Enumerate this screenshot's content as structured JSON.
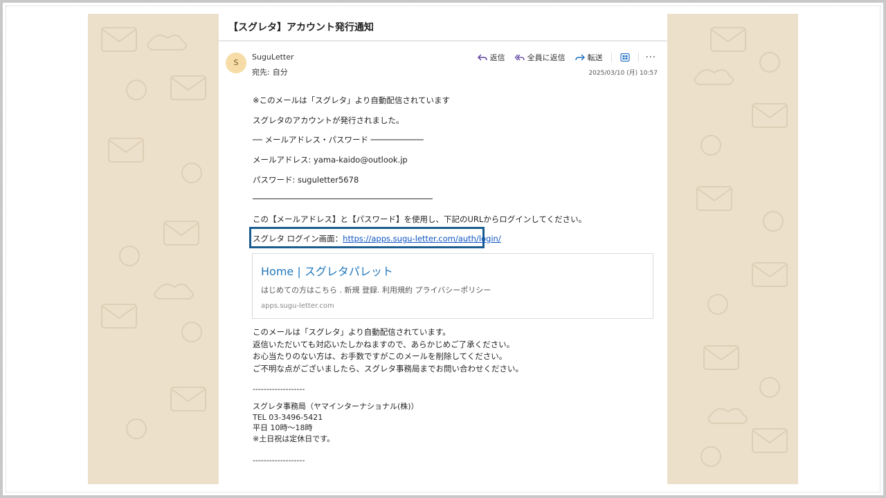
{
  "email": {
    "subject": "【スグレタ】アカウント発行通知",
    "sender_initial": "S",
    "sender_name": "SuguLetter",
    "recipient_label": "宛先:",
    "recipient_name": "自分",
    "date": "2025/03/10 (月) 10:57"
  },
  "actions": {
    "reply": "返信",
    "reply_all": "全員に返信",
    "forward": "転送",
    "more": "···"
  },
  "body": {
    "line1": "※このメールは「スグレタ」より自動配信されています",
    "line2": "スグレタのアカウントが発行されました。",
    "line3": "── メールアドレス・パスワード ───────────",
    "email_line": "メールアドレス: yama-kaido@outlook.jp",
    "password_line": "パスワード: suguletter5678",
    "instruction": "この【メールアドレス】と【パスワード】を使用し、下記のURLからログインしてください。",
    "login_label": "スグレタ ログイン画面：",
    "login_url": "https://apps.sugu-letter.com/auth/login/"
  },
  "preview_card": {
    "title": "Home | スグレタパレット",
    "description": "はじめての方はこちら . 新規 登録. 利用規約 プライバシーポリシー",
    "domain": "apps.sugu-letter.com"
  },
  "notice": {
    "l1": "このメールは「スグレタ」より自動配信されています。",
    "l2": "返信いただいても対応いたしかねますので、あらかじめご了承ください。",
    "l3": "お心当たりのない方は、お手数ですがこのメールを削除してください。",
    "l4": "ご不明な点がございましたら、スグレタ事務局までお問い合わせください。"
  },
  "signature": {
    "dashes_top": "-------------------",
    "org": "スグレタ事務局（ヤマインターナショナル(株)）",
    "tel": "TEL 03-3496-5421",
    "hours": "平日 10時～18時",
    "holiday": "※土日祝は定休日です。",
    "dashes_bottom": "-------------------"
  },
  "colors": {
    "accent_border": "#1a5c8f",
    "link": "#0b53c2",
    "background_pattern": "#ece0cb",
    "avatar": "#f6dca6"
  }
}
